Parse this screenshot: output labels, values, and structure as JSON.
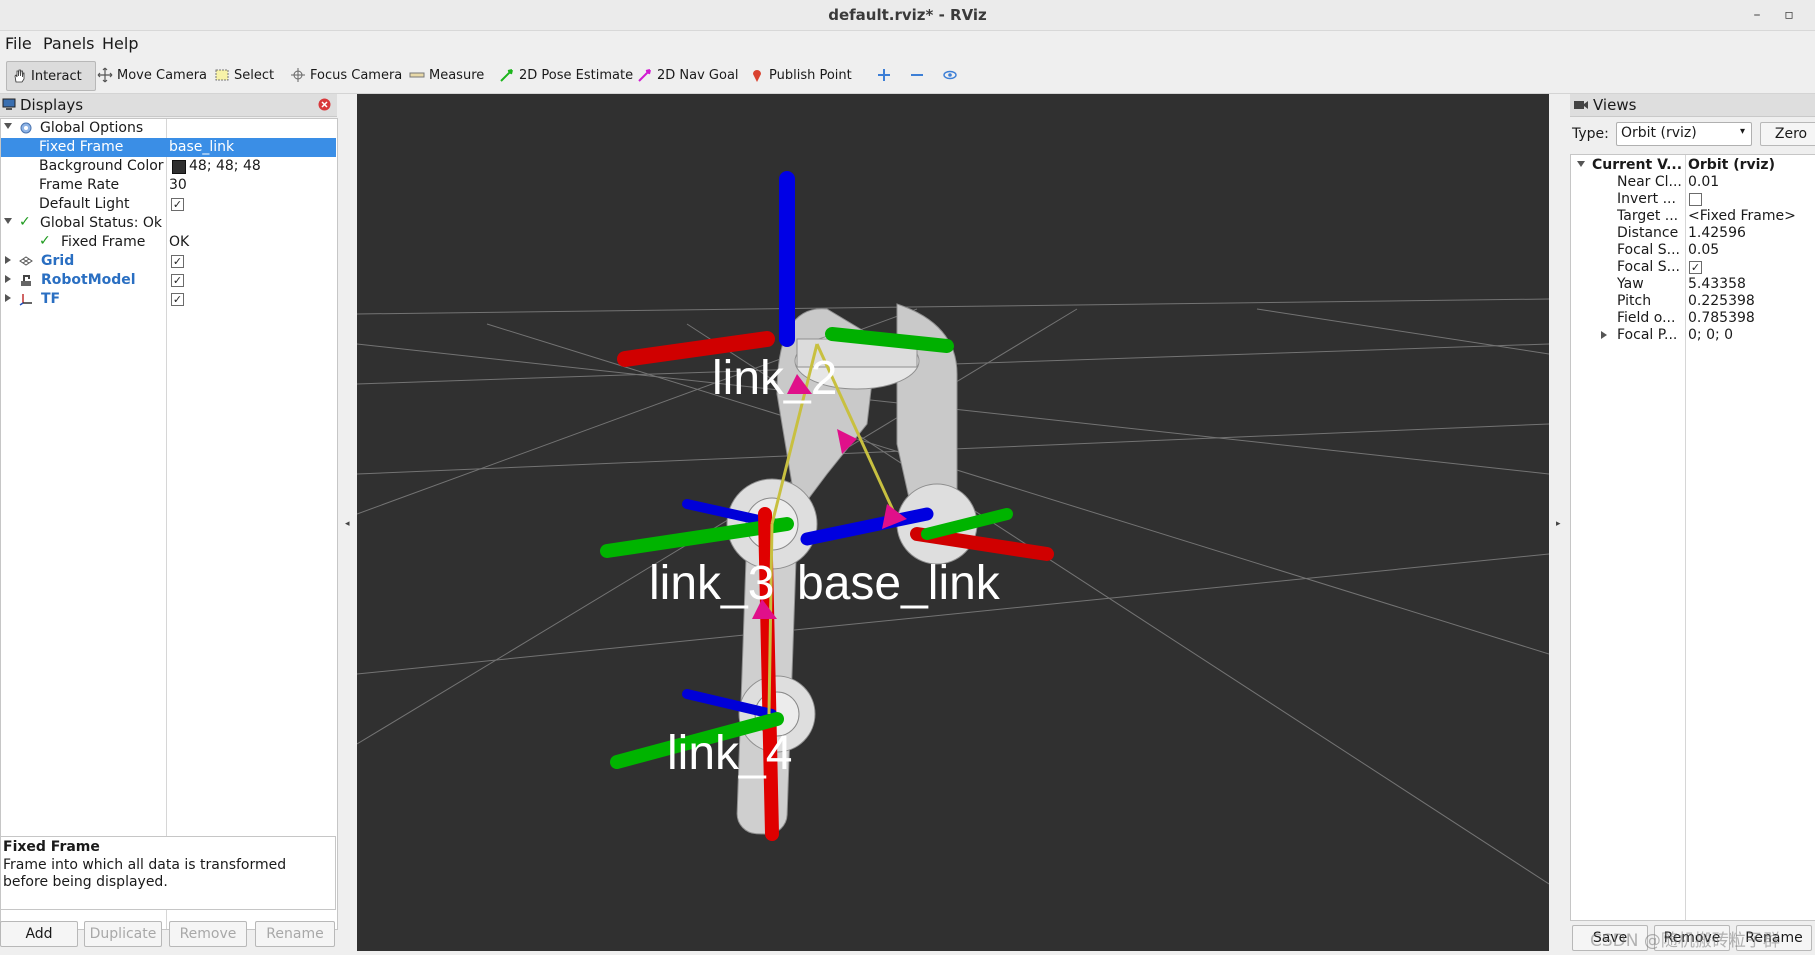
{
  "window": {
    "title": "default.rviz* - RViz",
    "minimize": "–",
    "maximize": "▫"
  },
  "menu": {
    "items": [
      "File",
      "Panels",
      "Help"
    ]
  },
  "toolbar": {
    "tools": [
      "Interact",
      "Move Camera",
      "Select",
      "Focus Camera",
      "Measure",
      "2D Pose Estimate",
      "2D Nav Goal",
      "Publish Point"
    ],
    "icons": [
      "hand-icon",
      "move-icon",
      "select-icon",
      "focus-icon",
      "ruler-icon",
      "pose-arrow-icon",
      "nav-arrow-icon",
      "pin-icon",
      "plus-icon",
      "minus-icon",
      "eye-icon"
    ]
  },
  "displays": {
    "title": "Displays",
    "rows": [
      {
        "key": "Global Options",
        "value": ""
      },
      {
        "key": "Fixed Frame",
        "value": "base_link"
      },
      {
        "key": "Background Color",
        "value": "48; 48; 48"
      },
      {
        "key": "Frame Rate",
        "value": "30"
      },
      {
        "key": "Default Light",
        "value": ""
      },
      {
        "key": "Global Status: Ok",
        "value": ""
      },
      {
        "key": "Fixed Frame",
        "value": "OK"
      },
      {
        "key": "Grid",
        "value": ""
      },
      {
        "key": "RobotModel",
        "value": ""
      },
      {
        "key": "TF",
        "value": ""
      }
    ],
    "check": "✓",
    "description": {
      "title": "Fixed Frame",
      "text": "Frame into which all data is transformed before being displayed."
    },
    "buttons": [
      "Add",
      "Duplicate",
      "Remove",
      "Rename"
    ],
    "background_color": "#303030"
  },
  "viewport": {
    "labels": [
      "link_2",
      "link_3",
      "base_link",
      "link_4"
    ],
    "colors": {
      "x": "#e00000",
      "y": "#00b400",
      "z": "#0000e6",
      "bg": "#303030"
    }
  },
  "views": {
    "title": "Views",
    "type_label": "Type:",
    "type_value": "Orbit (rviz)",
    "zero_button": "Zero",
    "rows": [
      {
        "key": "Current V...",
        "value": "Orbit (rviz)"
      },
      {
        "key": "Near Cl...",
        "value": "0.01"
      },
      {
        "key": "Invert ...",
        "value": ""
      },
      {
        "key": "Target ...",
        "value": "<Fixed Frame>"
      },
      {
        "key": "Distance",
        "value": "1.42596"
      },
      {
        "key": "Focal S...",
        "value": "0.05"
      },
      {
        "key": "Focal S...",
        "value": ""
      },
      {
        "key": "Yaw",
        "value": "5.43358"
      },
      {
        "key": "Pitch",
        "value": "0.225398"
      },
      {
        "key": "Field o...",
        "value": "0.785398"
      },
      {
        "key": "Focal P...",
        "value": "0; 0; 0"
      }
    ],
    "buttons": [
      "Save",
      "Remove",
      "Rename"
    ],
    "watermark": "CSDN @随机搬砖粒子群"
  }
}
